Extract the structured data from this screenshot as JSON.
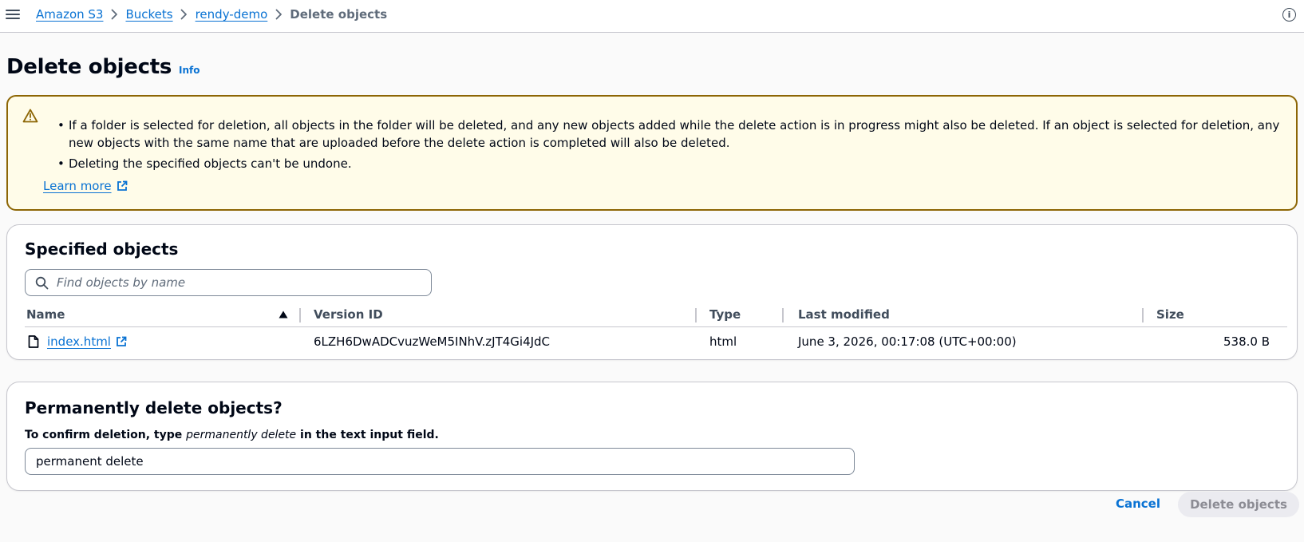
{
  "breadcrumb": {
    "items": [
      "Amazon S3",
      "Buckets",
      "rendy-demo"
    ],
    "current": "Delete objects"
  },
  "header": {
    "info_icon_glyph": "i",
    "title": "Delete objects",
    "info_link": "Info"
  },
  "alert": {
    "bullets": [
      "If a folder is selected for deletion, all objects in the folder will be deleted, and any new objects added while the delete action is in progress might also be deleted. If an object is selected for deletion, any new objects with the same name that are uploaded before the delete action is completed will also be deleted.",
      "Deleting the specified objects can't be undone."
    ],
    "learn_more": "Learn more",
    "color_border": "#8d6605",
    "color_bg": "#fffce9"
  },
  "specified_objects": {
    "title": "Specified objects",
    "search_placeholder": "Find objects by name",
    "columns": [
      "Name",
      "Version ID",
      "Type",
      "Last modified",
      "Size"
    ],
    "rows": [
      {
        "name": "index.html",
        "version_id": "6LZH6DwADCvuzWeM5INhV.zJT4Gi4JdC",
        "type": "html",
        "last_modified": "June 3, 2026, 00:17:08 (UTC+00:00)",
        "size": "538.0 B"
      }
    ]
  },
  "confirm": {
    "title": "Permanently delete objects?",
    "label_prefix": "To confirm deletion, type ",
    "label_em": "permanently delete",
    "label_suffix": " in the text input field.",
    "input_value": "permanent delete"
  },
  "actions": {
    "cancel": "Cancel",
    "delete": "Delete objects"
  },
  "icons": {
    "menu": "hamburger-menu-icon",
    "info": "info-icon",
    "warning": "warning-icon",
    "external": "external-link-icon",
    "search": "search-icon",
    "sort": "sort-ascending-icon",
    "file": "file-icon"
  },
  "colors": {
    "link": "#0972d3",
    "text": "#000716",
    "secondary_text": "#414d5c"
  }
}
